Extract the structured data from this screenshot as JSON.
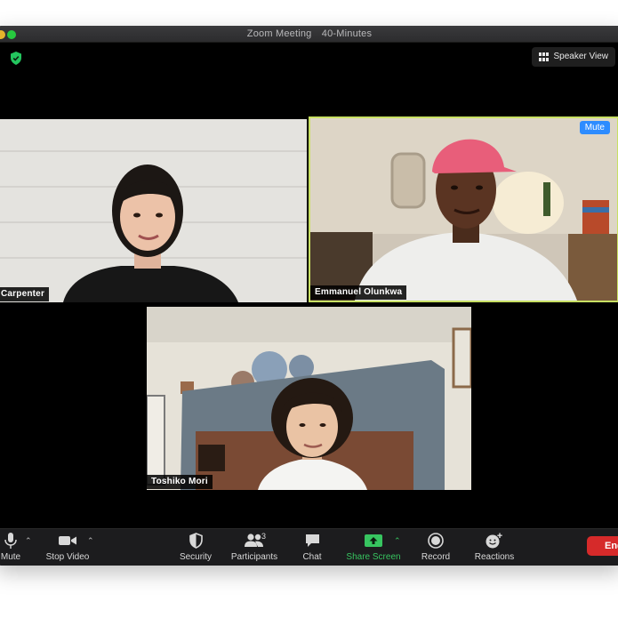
{
  "window": {
    "title": "Zoom Meeting",
    "subtitle": "40-Minutes"
  },
  "view_button": {
    "label": "Speaker View",
    "icon": "grid-icon"
  },
  "participants": [
    {
      "name": "Carpenter",
      "active_speaker": false
    },
    {
      "name": "Emmanuel Olunkwa",
      "active_speaker": true,
      "badge": "Mute"
    },
    {
      "name": "Toshiko Mori",
      "active_speaker": false
    }
  ],
  "toolbar": {
    "mute": "Mute",
    "stop_video": "Stop Video",
    "security": "Security",
    "participants": "Participants",
    "participants_count": "3",
    "chat": "Chat",
    "share_screen": "Share Screen",
    "record": "Record",
    "reactions": "Reactions",
    "end": "End"
  },
  "colors": {
    "accent_blue": "#2d8cff",
    "active_speaker_border": "#c8e063",
    "share_green": "#37c560",
    "end_red": "#d62a2a"
  }
}
